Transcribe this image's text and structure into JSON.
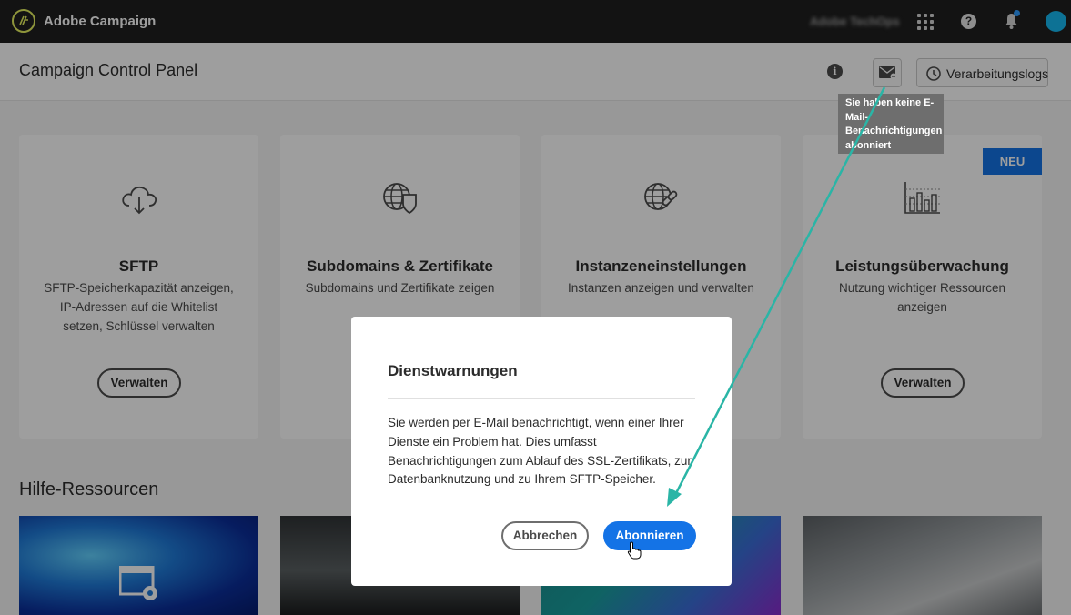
{
  "topbar": {
    "app_title": "Adobe Campaign",
    "org_name": "Adobe TechOps",
    "icons": [
      "adobe-campaign-logo-icon",
      "apps-grid-icon",
      "help-icon",
      "bell-icon",
      "avatar"
    ]
  },
  "header": {
    "title": "Campaign Control Panel",
    "logs_button": "Verarbeitungslogs",
    "tooltip": "Sie haben keine E-Mail-Benachrichtigungen abonniert"
  },
  "cards": [
    {
      "title": "SFTP",
      "description": "SFTP-Speicherkapazität anzeigen, IP-Adressen auf die Whitelist setzen, Schlüssel verwalten",
      "button": "Verwalten",
      "icon": "cloud-download-icon"
    },
    {
      "title": "Subdomains & Zertifikate",
      "description": "Subdomains und Zertifikate zeigen",
      "button": "",
      "icon": "globe-shield-icon"
    },
    {
      "title": "Instanzeneinstellungen",
      "description": "Instanzen anzeigen und verwalten",
      "button": "",
      "icon": "globe-link-icon"
    },
    {
      "title": "Leistungsüberwachung",
      "description": "Nutzung wichtiger Ressourcen anzeigen",
      "button": "Verwalten",
      "icon": "bar-chart-icon",
      "badge": "NEU"
    }
  ],
  "resources": {
    "title": "Hilfe-Ressourcen"
  },
  "dialog": {
    "title": "Dienstwarnungen",
    "body": "Sie werden per E-Mail benachrichtigt, wenn einer Ihrer Dienste ein Problem hat. Dies umfasst Benachrichtigungen zum Ablauf des SSL-Zertifikats, zur Datenbanknutzung und zu Ihrem SFTP-Speicher.",
    "cancel": "Abbrechen",
    "confirm": "Abonnieren"
  },
  "colors": {
    "accent": "#1473e6",
    "annotation": "#2ab5a6",
    "topbar": "#1f1f1f"
  }
}
